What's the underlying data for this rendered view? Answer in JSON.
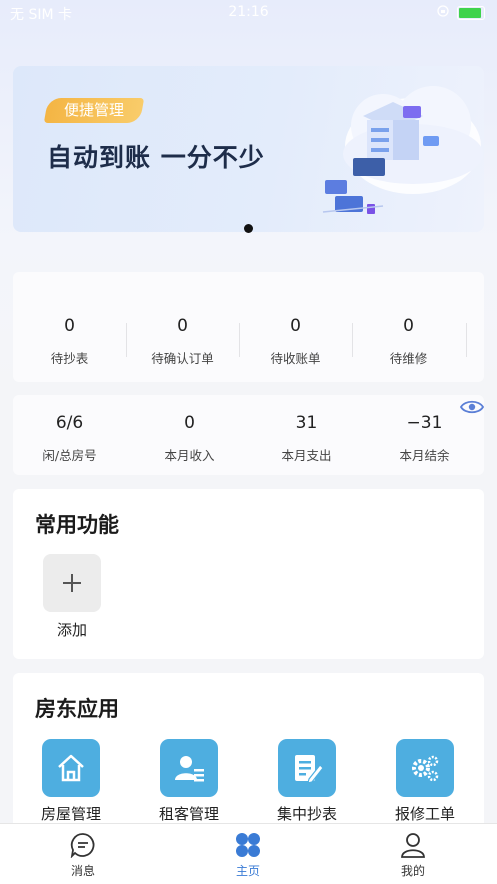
{
  "status_bar": {
    "carrier": "无 SIM 卡",
    "time": "21:16"
  },
  "banner": {
    "tag": "便捷管理",
    "slogan": "自动到账  一分不少"
  },
  "stats_row1": [
    {
      "value": "0",
      "label": "待抄表"
    },
    {
      "value": "0",
      "label": "待确认订单"
    },
    {
      "value": "0",
      "label": "待收账单"
    },
    {
      "value": "0",
      "label": "待维修"
    }
  ],
  "stats_row2": [
    {
      "value": "6/6",
      "label": "闲/总房号"
    },
    {
      "value": "0",
      "label": "本月收入"
    },
    {
      "value": "31",
      "label": "本月支出"
    },
    {
      "value": "−31",
      "label": "本月结余"
    }
  ],
  "common": {
    "title": "常用功能",
    "add_label": "添加"
  },
  "landlord": {
    "title": "房东应用",
    "apps": [
      {
        "label": "房屋管理",
        "icon": "house-icon"
      },
      {
        "label": "租客管理",
        "icon": "tenant-icon"
      },
      {
        "label": "集中抄表",
        "icon": "meter-edit-icon"
      },
      {
        "label": "报修工单",
        "icon": "repair-gear-icon"
      }
    ]
  },
  "tabbar": {
    "items": [
      {
        "label": "消息",
        "icon": "message-icon"
      },
      {
        "label": "主页",
        "icon": "home-grid-icon",
        "active": true
      },
      {
        "label": "我的",
        "icon": "profile-icon"
      }
    ]
  },
  "colors": {
    "accent": "#3a7bd5",
    "app_icon_bg": "#4eaee0",
    "tag_bg": "#f4b544"
  }
}
